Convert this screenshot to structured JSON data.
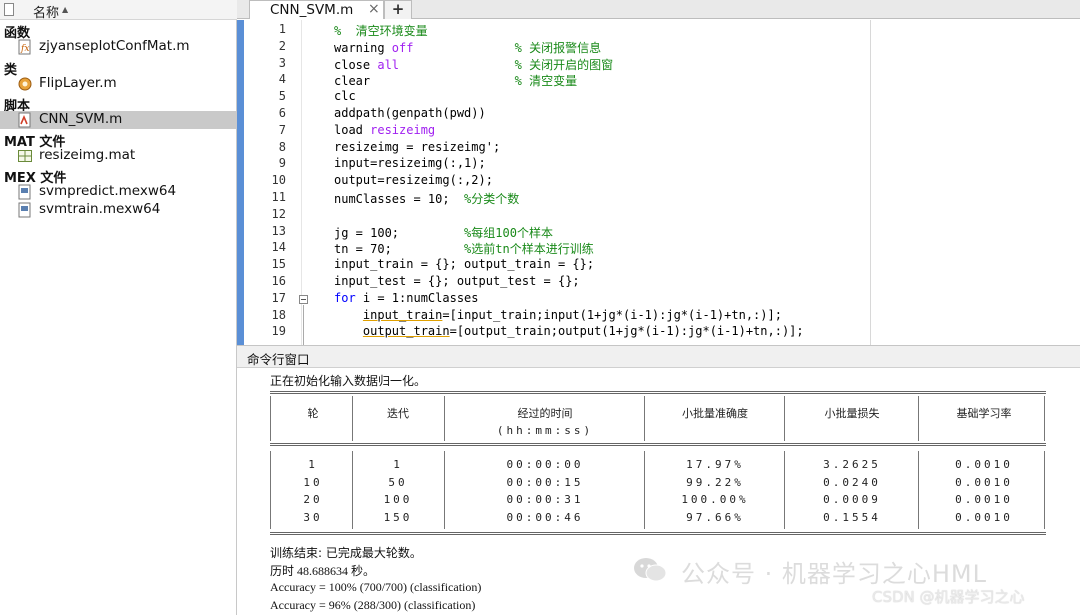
{
  "file_browser": {
    "header_label": "名称",
    "groups": [
      {
        "label": "函数"
      },
      {
        "label": "类"
      },
      {
        "label": "脚本"
      },
      {
        "label": "MAT 文件"
      },
      {
        "label": "MEX 文件"
      }
    ],
    "files": [
      {
        "name": "zjyanseplotConfMat.m",
        "icon": "function-file-icon"
      },
      {
        "name": "FlipLayer.m",
        "icon": "class-file-icon"
      },
      {
        "name": "CNN_SVM.m",
        "icon": "script-file-icon",
        "selected": true
      },
      {
        "name": "resizeimg.mat",
        "icon": "mat-file-icon"
      },
      {
        "name": "svmpredict.mexw64",
        "icon": "mex-file-icon"
      },
      {
        "name": "svmtrain.mexw64",
        "icon": "mex-file-icon"
      }
    ]
  },
  "editor": {
    "tab_label": "CNN_SVM.m",
    "tab_close": "×",
    "add_tab": "+",
    "line_numbers": [
      "1",
      "2",
      "3",
      "4",
      "5",
      "6",
      "7",
      "8",
      "9",
      "10",
      "11",
      "12",
      "13",
      "14",
      "15",
      "16",
      "17",
      "18",
      "19"
    ],
    "code": [
      [
        {
          "t": "%  清空环境变量",
          "c": "c"
        }
      ],
      [
        {
          "t": "warning "
        },
        {
          "t": "off",
          "c": "s"
        },
        {
          "t": "              "
        },
        {
          "t": "% 关闭报警信息",
          "c": "c"
        }
      ],
      [
        {
          "t": "close "
        },
        {
          "t": "all",
          "c": "s"
        },
        {
          "t": "                "
        },
        {
          "t": "% 关闭开启的图窗",
          "c": "c"
        }
      ],
      [
        {
          "t": "clear                    "
        },
        {
          "t": "% 清空变量",
          "c": "c"
        }
      ],
      [
        {
          "t": "clc"
        }
      ],
      [
        {
          "t": "addpath(genpath(pwd))"
        }
      ],
      [
        {
          "t": "load "
        },
        {
          "t": "resizeimg",
          "c": "s"
        }
      ],
      [
        {
          "t": "resizeimg = resizeimg';"
        }
      ],
      [
        {
          "t": "input=resizeimg(:,1);"
        }
      ],
      [
        {
          "t": "output=resizeimg(:,2);"
        }
      ],
      [
        {
          "t": "numClasses = 10;  "
        },
        {
          "t": "%分类个数",
          "c": "c"
        }
      ],
      [
        {
          "t": ""
        }
      ],
      [
        {
          "t": "jg = 100;         "
        },
        {
          "t": "%每组100个样本",
          "c": "c"
        }
      ],
      [
        {
          "t": "tn = 70;          "
        },
        {
          "t": "%选前tn个样本进行训练",
          "c": "c"
        }
      ],
      [
        {
          "t": "input_train = {}; output_train = {};"
        }
      ],
      [
        {
          "t": "input_test = {}; output_test = {};"
        }
      ],
      [
        {
          "t": "for",
          "c": "k"
        },
        {
          "t": " i = 1:numClasses"
        }
      ],
      [
        {
          "t": "    "
        },
        {
          "t": "input_train",
          "c": "u"
        },
        {
          "t": "=[input_train;input(1+jg*(i-1):jg*(i-1)+tn,:)];"
        }
      ],
      [
        {
          "t": "    "
        },
        {
          "t": "output_train",
          "c": "u"
        },
        {
          "t": "=[output_train;output(1+jg*(i-1):jg*(i-1)+tn,:)];"
        }
      ]
    ]
  },
  "command_window": {
    "title": "命令行窗口",
    "init_text": "正在初始化输入数据归一化。",
    "table": {
      "headers": [
        "轮",
        "迭代",
        "经过的时间",
        "小批量准确度",
        "小批量损失",
        "基础学习率"
      ],
      "subheader": "(hh:mm:ss)",
      "rows": [
        [
          "1",
          "1",
          "00:00:00",
          "17.97%",
          "3.2625",
          "0.0010"
        ],
        [
          "10",
          "50",
          "00:00:15",
          "99.22%",
          "0.0240",
          "0.0010"
        ],
        [
          "20",
          "100",
          "00:00:31",
          "100.00%",
          "0.0009",
          "0.0010"
        ],
        [
          "30",
          "150",
          "00:00:46",
          "97.66%",
          "0.1554",
          "0.0010"
        ]
      ]
    },
    "done_text": "训练结束: 已完成最大轮数。",
    "elapsed_text": "历时 48.688634 秒。",
    "accuracy_train": "Accuracy = 100% (700/700) (classification)",
    "accuracy_test": "Accuracy = 96% (288/300) (classification)"
  },
  "watermark": {
    "text": "公众号 · 机器学习之心HML",
    "csdn": "CSDN @机器学习之心"
  },
  "colors": {
    "comment": "#1a8a1a",
    "string": "#a020f0",
    "keyword": "#0000ff",
    "selection": "#c9c9c9"
  }
}
